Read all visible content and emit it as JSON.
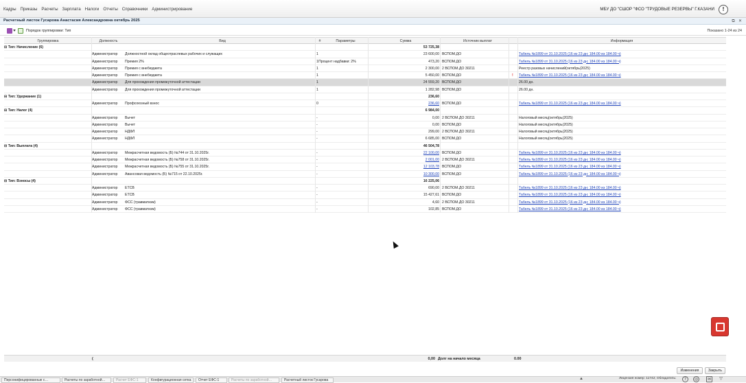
{
  "menu": [
    "Кадры",
    "Приказы",
    "Расчеты",
    "Зарплата",
    "Налоги",
    "Отчеты",
    "Справочники",
    "Администрирование"
  ],
  "org": "МБУ ДО \"СШОР \"ФСО \"ТРУДОВЫЕ РЕЗЕРВЫ\" Г.КАЗАНИ",
  "window_title": "Расчетный листок Гусарова Анастасия Александровна октябрь 2025",
  "toolbar": {
    "grouping_label": "Порядок группировки: Тип",
    "shown": "Показано 1-24 из 24"
  },
  "columns": [
    "Группировка",
    "Должность",
    "Вид",
    "#",
    "Параметры",
    "Сумма",
    "Источник выплат",
    "Информация"
  ],
  "rows": [
    {
      "group": "⊟ Тип: Начисление (6)",
      "pos": "",
      "kind": "",
      "num": "",
      "params": "",
      "sum": "53 725,38",
      "src": "",
      "info": ""
    },
    {
      "group": "",
      "pos": "Администратор",
      "kind": "Должностной оклад общеотраслевых рабочих и служащих",
      "num": "1",
      "params": "",
      "sum": "23 600,00",
      "src": "ВСПОМ.ДО",
      "info": "Табель №1899 от 31.10.2025 (16 из 23 дн; 184.00 из 184.00 ч)",
      "link": true
    },
    {
      "group": "",
      "pos": "Администратор",
      "kind": "Премия 2%",
      "num": "1",
      "params": "Процент надбавки: 2%",
      "sum": "473,20",
      "src": "ВСПОМ.ДО",
      "info": "Табель №1899 от 31.10.2025 (16 из 23 дн; 184.00 из 184.00 ч)",
      "link": true
    },
    {
      "group": "",
      "pos": "Администратор",
      "kind": "Премия с внебюджета",
      "num": "1",
      "params": "",
      "sum": "2 300,00",
      "src": "2 ВСПОМ.ДО 30211",
      "info": "Реестр разовых начислений(октябрь(2025)"
    },
    {
      "group": "",
      "pos": "Администратор",
      "kind": "Премия с внебюджета",
      "num": "1",
      "params": "",
      "sum": "5 450,00",
      "src": "ВСПОМ.ДО",
      "info": "Табель №1899 от 31.10.2025 (16 из 23 дн; 184.00 из 184.00 ч)",
      "link": true,
      "flag": "!"
    },
    {
      "group": "",
      "pos": "Администратор",
      "kind": "Для прохождения промежуточной аттестации",
      "num": "1",
      "params": "",
      "sum": "24 559,20",
      "src": "ВСПОМ.ДО",
      "info": "26.00 дн.",
      "sel": true
    },
    {
      "group": "",
      "pos": "Администратор",
      "kind": "Для прохождения промежуточной аттестации",
      "num": "1",
      "params": "",
      "sum": "1 282,98",
      "src": "ВСПОМ.ДО",
      "info": "26.00 дн."
    },
    {
      "group": "⊟ Тип: Удержание (1)",
      "pos": "",
      "kind": "",
      "num": "",
      "params": "",
      "sum": "236,60",
      "src": "",
      "info": ""
    },
    {
      "group": "",
      "pos": "Администратор",
      "kind": "Профсоюзный взнос",
      "num": "0",
      "params": "",
      "sum": "236,60",
      "sumlink": true,
      "src": "ВСПОМ.ДО",
      "info": "Табель №1899 от 31.10.2025 (16 из 23 дн; 184.00 из 184.00 ч)",
      "link": true
    },
    {
      "group": "⊟ Тип: Налог (4)",
      "pos": "",
      "kind": "",
      "num": "",
      "params": "",
      "sum": "6 984,00",
      "src": "",
      "info": ""
    },
    {
      "group": "",
      "pos": "Администратор",
      "kind": "Вычет",
      "num": "-",
      "params": "",
      "sum": "0,00",
      "src": "2 ВСПОМ.ДО 30211",
      "info": "Налоговый месяц(октябрь(2025)"
    },
    {
      "group": "",
      "pos": "Администратор",
      "kind": "Вычет",
      "num": "-",
      "params": "",
      "sum": "0,00",
      "src": "ВСПОМ.ДО",
      "info": "Налоговый месяц(октябрь(2025)"
    },
    {
      "group": "",
      "pos": "Администратор",
      "kind": "НДФЛ",
      "num": "-",
      "params": "",
      "sum": "299,00",
      "src": "2 ВСПОМ.ДО 30211",
      "info": "Налоговый месяц(октябрь(2025)"
    },
    {
      "group": "",
      "pos": "Администратор",
      "kind": "НДФЛ",
      "num": "-",
      "params": "",
      "sum": "6 685,00",
      "src": "ВСПОМ.ДО",
      "info": "Налоговый месяц(октябрь(2025)"
    },
    {
      "group": "⊟ Тип: Выплата (4)",
      "pos": "",
      "kind": "",
      "num": "",
      "params": "",
      "sum": "46 504,78",
      "src": "",
      "info": ""
    },
    {
      "group": "",
      "pos": "Администратор",
      "kind": "Межрасчетная ведомость (Б) №744 от 31.10.2025г.",
      "num": "-",
      "params": "",
      "sum": "22 100,00",
      "sumlink": true,
      "src": "ВСПОМ.ДО",
      "info": "Табель №1899 от 31.10.2025 (16 из 23 дн; 184.00 из 184.00 ч)",
      "link": true
    },
    {
      "group": "",
      "pos": "Администратор",
      "kind": "Межрасчетная ведомость (Б) №758 от 31.10.2025г.",
      "num": "-",
      "params": "",
      "sum": "2 001,00",
      "sumlink": true,
      "src": "2 ВСПОМ.ДО 30211",
      "info": "Табель №1899 от 31.10.2025 (16 из 23 дн; 184.00 из 184.00 ч)",
      "link": true
    },
    {
      "group": "",
      "pos": "Администратор",
      "kind": "Межрасчетная ведомость (Б) №755 от 31.10.2025г.",
      "num": "-",
      "params": "",
      "sum": "12 103,78",
      "sumlink": true,
      "src": "ВСПОМ.ДО",
      "info": "Табель №1899 от 31.10.2025 (16 из 23 дн; 184.00 из 184.00 ч)",
      "link": true
    },
    {
      "group": "",
      "pos": "Администратор",
      "kind": "Авансовая ведомость (Б) №715 от 22.10.2025г.",
      "num": "-",
      "params": "",
      "sum": "10 300,00",
      "sumlink": true,
      "src": "ВСПОМ.ДО",
      "info": "Табель №1899 от 31.10.2025 (16 из 23 дн; 184.00 из 184.00 ч)",
      "link": true
    },
    {
      "group": "⊟ Тип: Взносы (4)",
      "pos": "",
      "kind": "",
      "num": "",
      "params": "",
      "sum": "16 225,06",
      "src": "",
      "info": ""
    },
    {
      "group": "",
      "pos": "Администратор",
      "kind": "ЕТСВ",
      "num": "-",
      "params": "",
      "sum": "690,00",
      "src": "2 ВСПОМ.ДО 30211",
      "info": "Табель №1899 от 31.10.2025 (16 из 23 дн; 184.00 из 184.00 ч)",
      "link": true
    },
    {
      "group": "",
      "pos": "Администратор",
      "kind": "ЕТСВ",
      "num": "-",
      "params": "",
      "sum": "15 427,61",
      "src": "ВСПОМ.ДО",
      "info": "Табель №1899 от 31.10.2025 (16 из 23 дн; 184.00 из 184.00 ч)",
      "link": true
    },
    {
      "group": "",
      "pos": "Администратор",
      "kind": "ФСС (травматизм)",
      "num": "-",
      "params": "",
      "sum": "4,60",
      "src": "2 ВСПОМ.ДО 30211",
      "info": "Табель №1899 от 31.10.2025 (16 из 23 дн; 184.00 из 184.00 ч)",
      "link": true
    },
    {
      "group": "",
      "pos": "Администратор",
      "kind": "ФСС (травматизм)",
      "num": "-",
      "params": "",
      "sum": "102,85",
      "src": "ВСПОМ.ДО",
      "info": "Табель №1899 от 31.10.2025 (16 из 23 дн; 184.00 из 184.00 ч)",
      "link": true
    }
  ],
  "footer": {
    "sum": "0,00",
    "label": "Долг на начало месяца",
    "value": "0.00"
  },
  "buttons": {
    "changes": "Изменения",
    "close": "Закрыть"
  },
  "taskbar": [
    {
      "label": "Персонифицированные с…",
      "dim": false
    },
    {
      "label": "Расчеты по заработной…",
      "dim": false
    },
    {
      "label": "Расчет ЕФС-1",
      "dim": true
    },
    {
      "label": "Конфигурационная сетка",
      "dim": false
    },
    {
      "label": "Отчет ЕФС-1",
      "dim": false
    },
    {
      "label": "Расчеты по заработной…",
      "dim": true
    },
    {
      "label": "Расчетный листок Гусарова",
      "dim": false
    }
  ],
  "status": {
    "text": "Лицензия номер: 11742; Обладатель:"
  }
}
